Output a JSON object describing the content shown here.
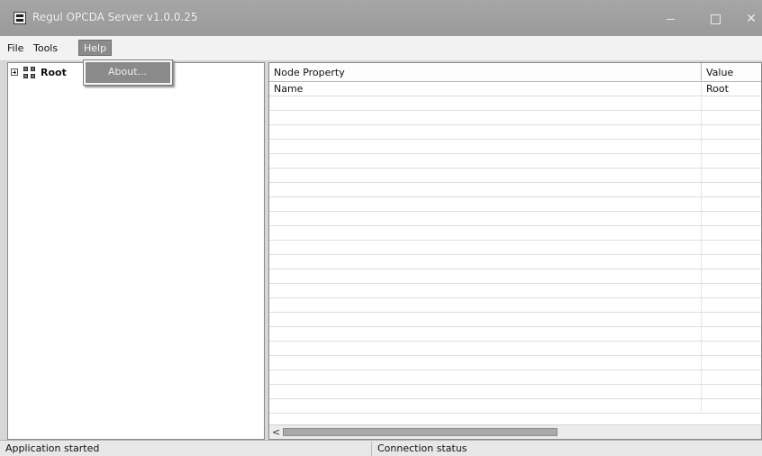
{
  "window": {
    "title": "Regul OPCDA Server v1.0.0.25",
    "icon": "application-icon",
    "controls": {
      "minimize": "minimize-icon",
      "maximize": "maximize-icon",
      "close": "✕"
    }
  },
  "menu": {
    "file": "File",
    "tools": "Tools",
    "help": "Help"
  },
  "help_dropdown": {
    "items": [
      {
        "label": "About..."
      }
    ]
  },
  "tree": {
    "root_label": "Root",
    "expand_icon": "plus-box-icon",
    "node_icon": "grid-icon"
  },
  "property_grid": {
    "headers": {
      "property": "Node Property",
      "value": "Value"
    },
    "rows": [
      {
        "property": "Name",
        "value": "Root"
      },
      {
        "property": "",
        "value": ""
      },
      {
        "property": "",
        "value": ""
      },
      {
        "property": "",
        "value": ""
      },
      {
        "property": "",
        "value": ""
      },
      {
        "property": "",
        "value": ""
      },
      {
        "property": "",
        "value": ""
      },
      {
        "property": "",
        "value": ""
      },
      {
        "property": "",
        "value": ""
      },
      {
        "property": "",
        "value": ""
      },
      {
        "property": "",
        "value": ""
      },
      {
        "property": "",
        "value": ""
      },
      {
        "property": "",
        "value": ""
      },
      {
        "property": "",
        "value": ""
      },
      {
        "property": "",
        "value": ""
      },
      {
        "property": "",
        "value": ""
      },
      {
        "property": "",
        "value": ""
      },
      {
        "property": "",
        "value": ""
      },
      {
        "property": "",
        "value": ""
      },
      {
        "property": "",
        "value": ""
      },
      {
        "property": "",
        "value": ""
      },
      {
        "property": "",
        "value": ""
      },
      {
        "property": "",
        "value": ""
      }
    ],
    "scroll_left": "<"
  },
  "status_bar": {
    "left": "Application started",
    "right": "Connection status"
  }
}
